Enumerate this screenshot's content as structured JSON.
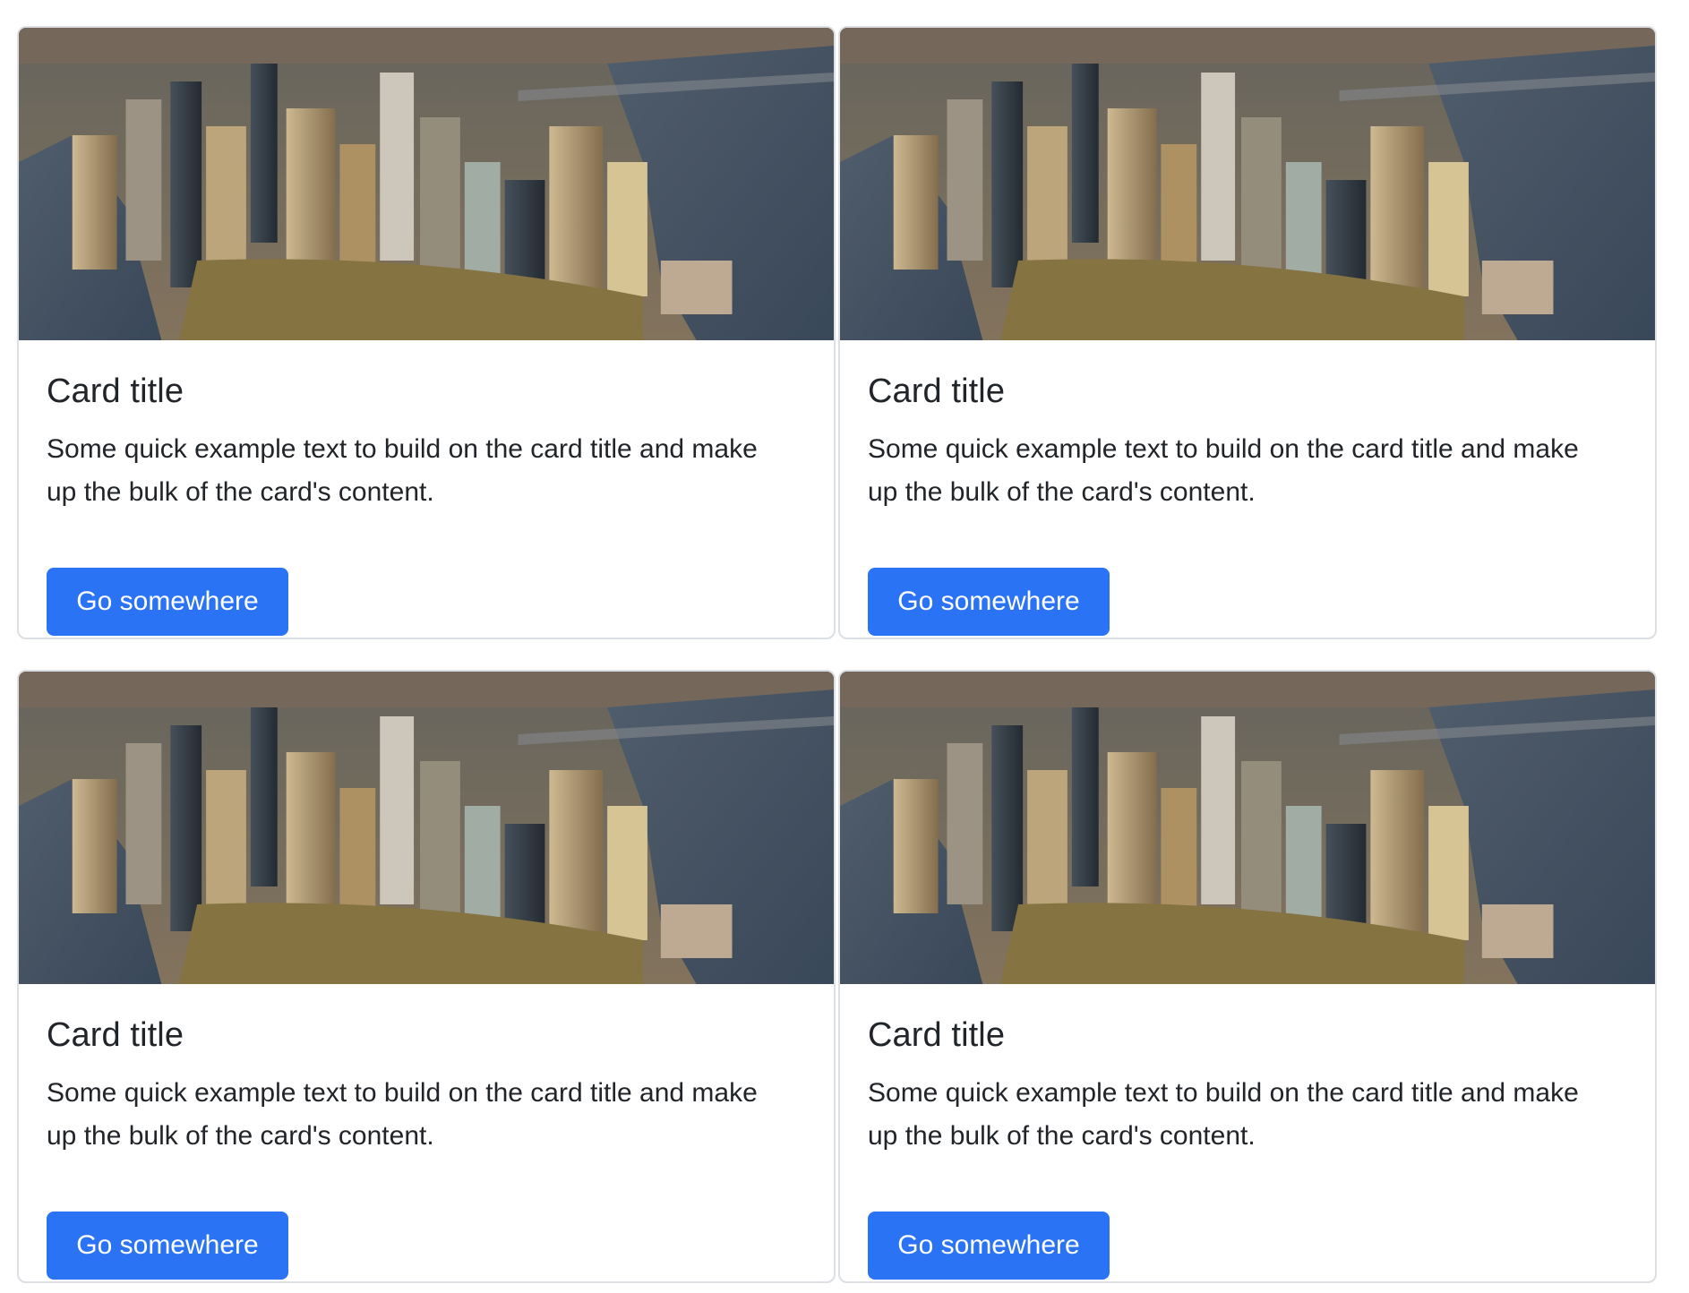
{
  "colors": {
    "primary": "#2a73f4",
    "text": "#212529",
    "border": "#dcdfe3"
  },
  "image": {
    "alt": "Aerial view of a city skyline"
  },
  "cards": [
    {
      "title": "Card title",
      "text": "Some quick example text to build on the card title and make up the bulk of the card's content.",
      "button_label": "Go somewhere"
    },
    {
      "title": "Card title",
      "text": "Some quick example text to build on the card title and make up the bulk of the card's content.",
      "button_label": "Go somewhere"
    },
    {
      "title": "Card title",
      "text": "Some quick example text to build on the card title and make up the bulk of the card's content.",
      "button_label": "Go somewhere"
    },
    {
      "title": "Card title",
      "text": "Some quick example text to build on the card title and make up the bulk of the card's content.",
      "button_label": "Go somewhere"
    }
  ]
}
